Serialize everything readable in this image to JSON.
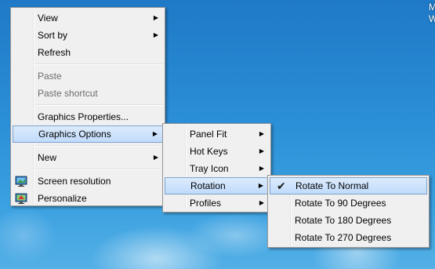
{
  "desktop": {
    "corner_text": "M W"
  },
  "main_menu": {
    "items": [
      {
        "label": "View",
        "has_submenu": true
      },
      {
        "label": "Sort by",
        "has_submenu": true
      },
      {
        "label": "Refresh"
      },
      {
        "label": "Paste",
        "disabled": true
      },
      {
        "label": "Paste shortcut",
        "disabled": true
      },
      {
        "label": "Graphics Properties..."
      },
      {
        "label": "Graphics Options",
        "has_submenu": true,
        "highlighted": true
      },
      {
        "label": "New",
        "has_submenu": true
      },
      {
        "label": "Screen resolution",
        "icon": "monitor-icon"
      },
      {
        "label": "Personalize",
        "icon": "personalize-icon"
      }
    ]
  },
  "graphics_options_menu": {
    "items": [
      {
        "label": "Panel Fit",
        "has_submenu": true
      },
      {
        "label": "Hot Keys",
        "has_submenu": true
      },
      {
        "label": "Tray Icon",
        "has_submenu": true
      },
      {
        "label": "Rotation",
        "has_submenu": true,
        "highlighted": true
      },
      {
        "label": "Profiles",
        "has_submenu": true
      }
    ]
  },
  "rotation_menu": {
    "items": [
      {
        "label": "Rotate To Normal",
        "checked": true,
        "highlighted": true
      },
      {
        "label": "Rotate To 90 Degrees"
      },
      {
        "label": "Rotate To 180 Degrees"
      },
      {
        "label": "Rotate To 270 Degrees"
      }
    ]
  },
  "glyphs": {
    "submenu_arrow": "▶",
    "check": "✔"
  }
}
